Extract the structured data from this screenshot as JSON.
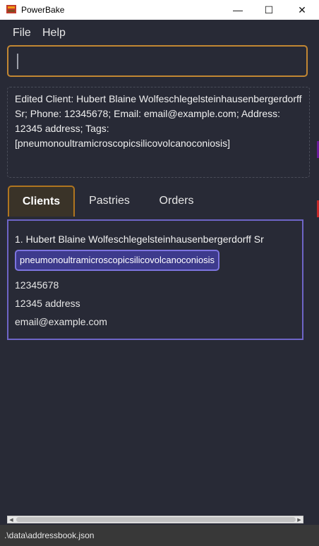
{
  "window": {
    "title": "PowerBake",
    "minimize_glyph": "—",
    "maximize_glyph": "☐",
    "close_glyph": "✕"
  },
  "menu": {
    "items": [
      "File",
      "Help"
    ]
  },
  "command": {
    "value": "",
    "placeholder": ""
  },
  "result": {
    "text": "Edited Client: Hubert Blaine Wolfeschlegelsteinhausenbergerdorff Sr; Phone: 12345678; Email: email@example.com; Address: 12345 address; Tags: [pneumonoultramicroscopicsilicovolcanoconiosis]"
  },
  "tabs": [
    {
      "label": "Clients",
      "active": true
    },
    {
      "label": "Pastries",
      "active": false
    },
    {
      "label": "Orders",
      "active": false
    }
  ],
  "clients": [
    {
      "index_name": "1.  Hubert Blaine Wolfeschlegelsteinhausenbergerdorff Sr",
      "tag": "pneumonoultramicroscopicsilicovolcanoconiosis",
      "phone": "12345678",
      "address": "12345 address",
      "email": "email@example.com"
    }
  ],
  "status": {
    "path": ".\\data\\addressbook.json"
  },
  "colors": {
    "background": "#282a36",
    "command_border": "#c28733",
    "list_border": "#6e65c7",
    "tag_fill": "#3d3a8c",
    "status_bar": "#383838"
  }
}
